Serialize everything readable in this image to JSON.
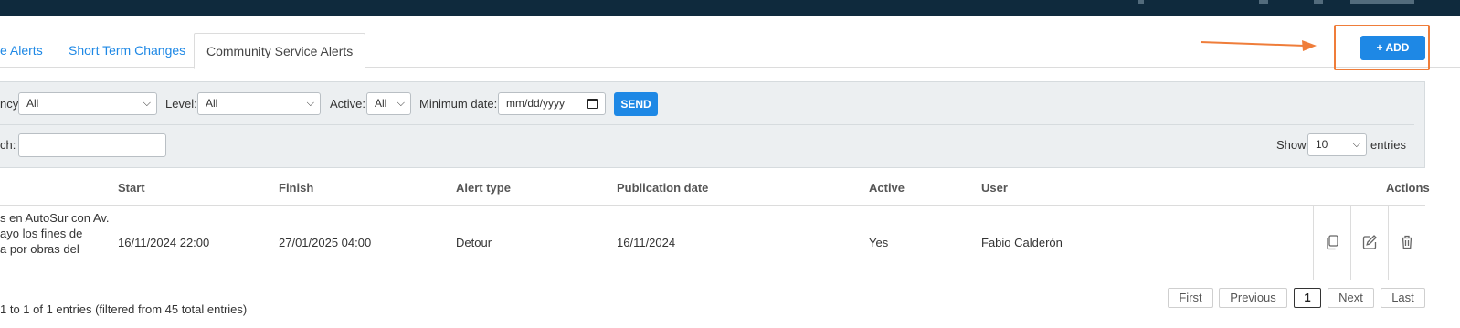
{
  "tabs": [
    {
      "label": "e Alerts"
    },
    {
      "label": "Short Term Changes"
    },
    {
      "label": "Community Service Alerts"
    }
  ],
  "add_button": {
    "label": "+ ADD"
  },
  "filters": {
    "agency_label": "ncy:",
    "agency_value": "All",
    "level_label": "Level:",
    "level_value": "All",
    "active_label": "Active:",
    "active_value": "All",
    "min_date_label": "Minimum date:",
    "min_date_placeholder": "mm/dd/yyyy",
    "send_label": "SEND",
    "search_label": "ch:",
    "search_value": "",
    "show_label": "Show",
    "show_value": "10",
    "entries_label": "entries"
  },
  "table": {
    "headers": {
      "start": "Start",
      "finish": "Finish",
      "alert_type": "Alert type",
      "publication_date": "Publication date",
      "active": "Active",
      "user": "User",
      "actions": "Actions"
    },
    "rows": [
      {
        "description_lines": [
          "s en AutoSur con Av.",
          "ayo los fines de",
          "a por obras del"
        ],
        "start": "16/11/2024 22:00",
        "finish": "27/01/2025 04:00",
        "alert_type": "Detour",
        "publication_date": "16/11/2024",
        "active": "Yes",
        "user": "Fabio Calderón"
      }
    ]
  },
  "footer": {
    "info": "1 to 1 of 1 entries (filtered from 45 total entries)",
    "pagination": {
      "first": "First",
      "previous": "Previous",
      "current": "1",
      "next": "Next",
      "last": "Last"
    }
  },
  "colors": {
    "topbar": "#0f2a3d",
    "accent": "#1e88e5",
    "highlight": "#ef7d3a",
    "filter_bg": "#eceff1"
  },
  "icons": {
    "copy": "copy-icon",
    "edit": "edit-icon",
    "delete": "trash-icon",
    "calendar": "calendar-icon",
    "dropdown": "chevron-down-icon"
  }
}
